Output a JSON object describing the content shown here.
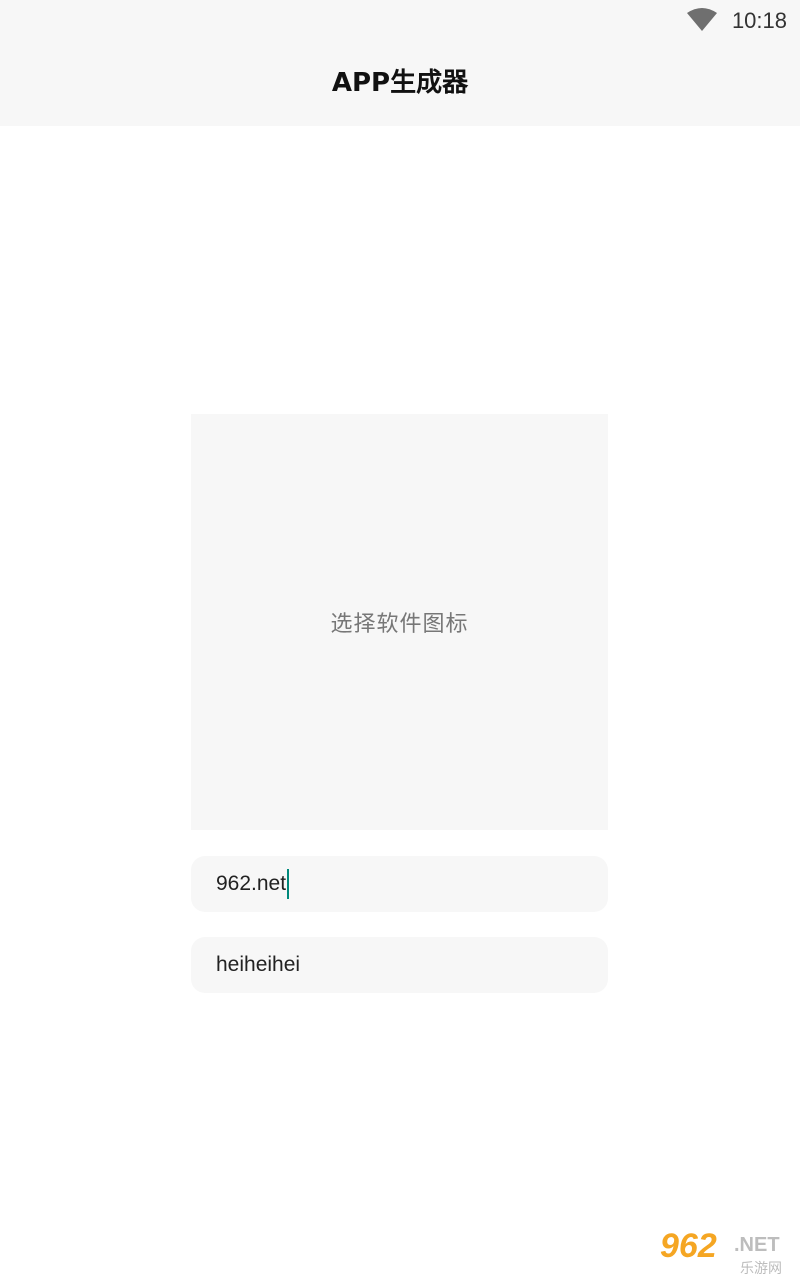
{
  "status_bar": {
    "time": "10:18",
    "wifi_icon": "wifi-icon"
  },
  "header": {
    "title": "APP生成器"
  },
  "icon_picker": {
    "label": "选择软件图标"
  },
  "form": {
    "fields": [
      {
        "value": "962.net",
        "focused": true
      },
      {
        "value": "heiheihei",
        "focused": false
      }
    ]
  },
  "watermark": {
    "logo_number": "962",
    "logo_suffix": ".NET",
    "logo_cn": "乐游网"
  },
  "colors": {
    "bar_background": "#f7f7f7",
    "field_background": "#f7f7f7",
    "caret": "#00897b",
    "watermark_orange": "#f5a623"
  }
}
